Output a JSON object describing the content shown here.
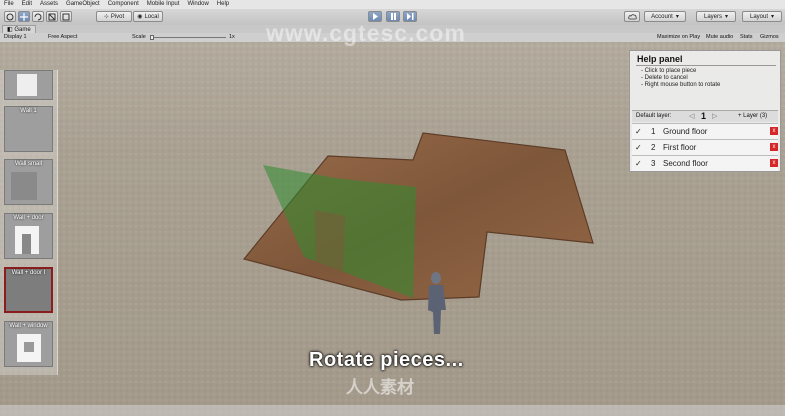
{
  "menubar": {
    "items": [
      "File",
      "Edit",
      "Assets",
      "GameObject",
      "Component",
      "Mobile Input",
      "Window",
      "Help"
    ]
  },
  "toolbar": {
    "pivot_label": "Pivot",
    "local_label": "Local",
    "account_label": "Account",
    "layers_label": "Layers",
    "layout_label": "Layout"
  },
  "tabs": {
    "game_label": "Game"
  },
  "game_toolbar": {
    "display_label": "Display 1",
    "aspect_label": "Free Aspect",
    "scale_label": "Scale",
    "scale_value": "1x",
    "maximize_label": "Maximize on Play",
    "mute_label": "Mute audio",
    "stats_label": "Stats",
    "gizmos_label": "Gizmos"
  },
  "sidebar": {
    "items": [
      {
        "label": ""
      },
      {
        "label": "Wall 1"
      },
      {
        "label": "Wall small"
      },
      {
        "label": "Wall + door"
      },
      {
        "label": "Wall + door I"
      },
      {
        "label": "Wall + window"
      }
    ]
  },
  "help_panel": {
    "title": "Help panel",
    "lines": [
      "- Click to place piece",
      "- Delete to cancel",
      "- Right mouse button to rotate"
    ],
    "default_layer_label": "Default layer:",
    "default_layer_value": "1",
    "add_layer_label": "+ Layer (3)",
    "layers": [
      {
        "index": "1",
        "name": "Ground floor"
      },
      {
        "index": "2",
        "name": "First floor"
      },
      {
        "index": "3",
        "name": "Second floor"
      }
    ]
  },
  "overlay": {
    "caption": "Rotate pieces...",
    "watermark_url": "www.cgtesc.com",
    "watermark_cn": "人人素材"
  },
  "colors": {
    "floor": "#8c6447",
    "ghost_piece": "#2f8c2f",
    "remove_button": "#d62626",
    "selected_border": "#8a1d1d"
  }
}
